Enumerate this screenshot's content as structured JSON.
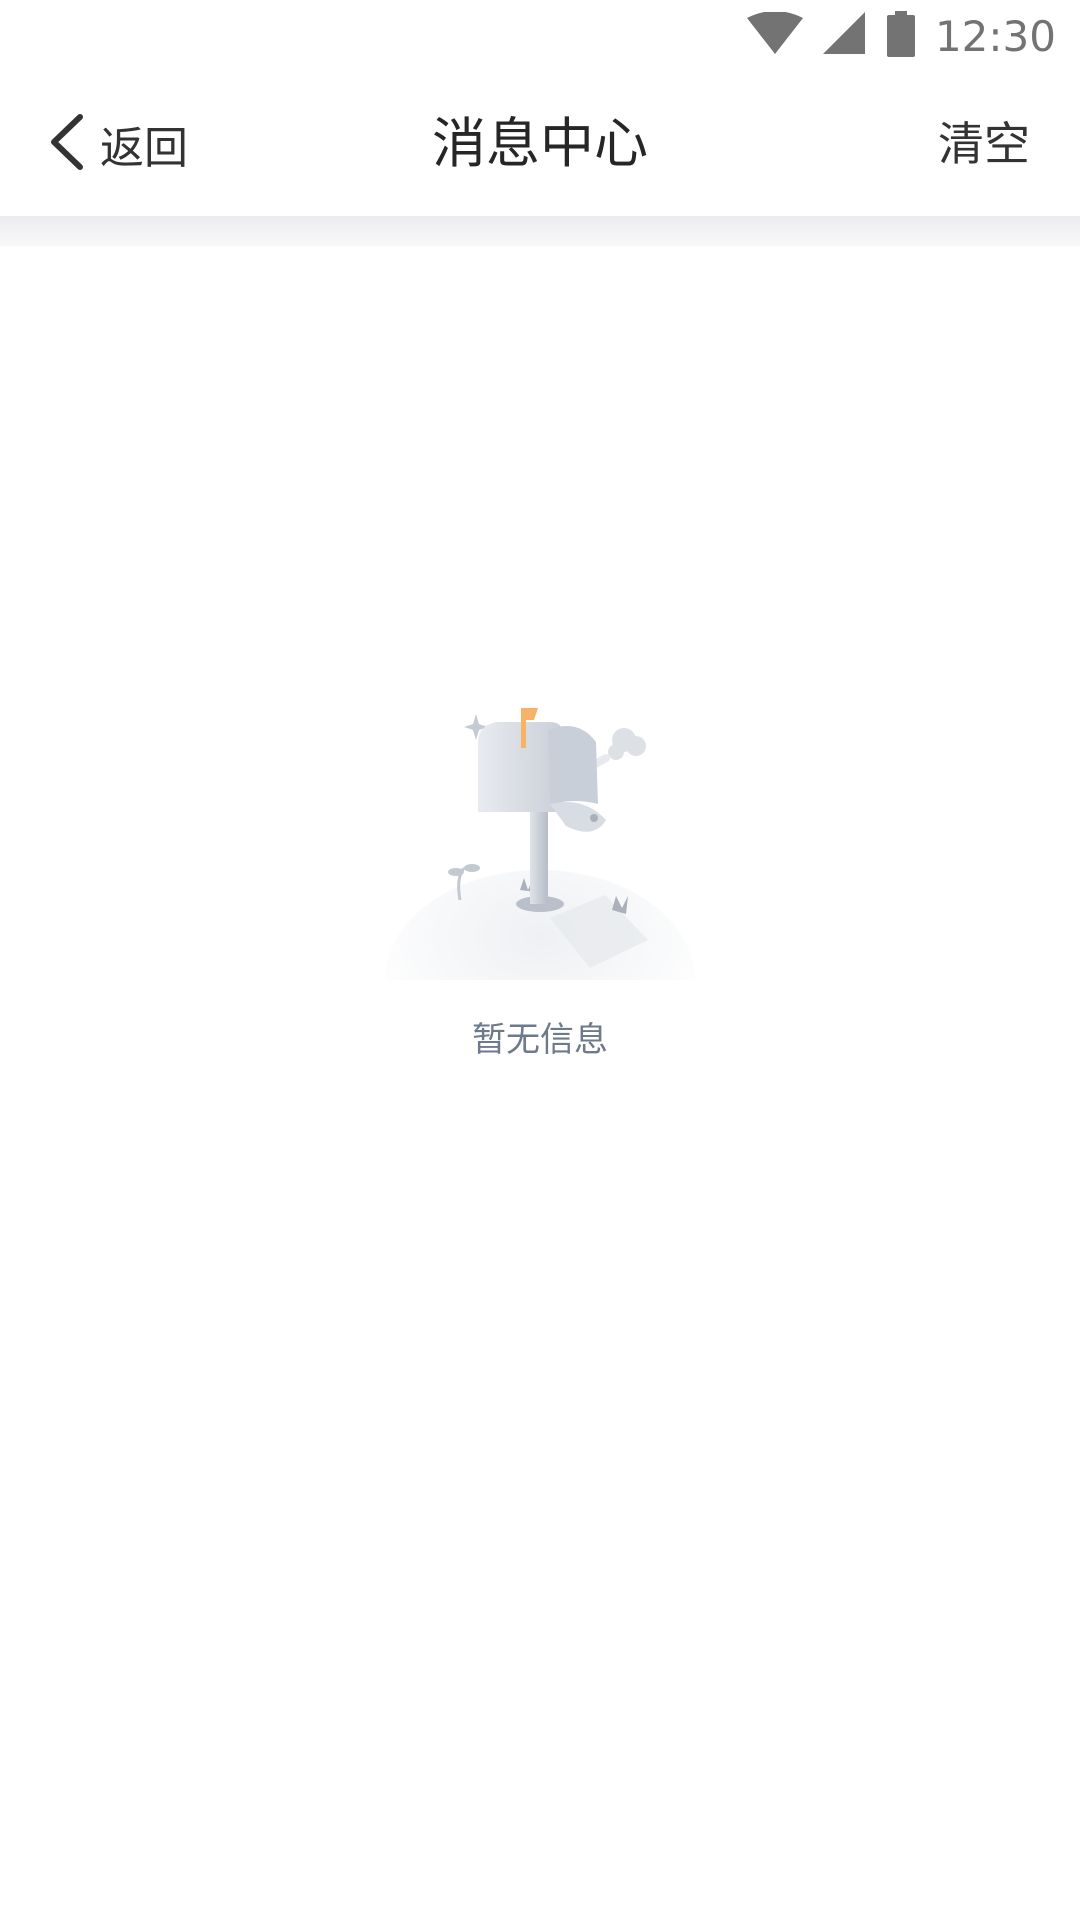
{
  "status_bar": {
    "time": "12:30",
    "icons": [
      "wifi-icon",
      "cell-signal-icon",
      "battery-icon"
    ],
    "icon_color": "#737373"
  },
  "nav": {
    "back_label": "返回",
    "title": "消息中心",
    "clear_label": "清空",
    "back_icon": "chevron-left-icon"
  },
  "empty_state": {
    "message": "暂无信息",
    "illustration": "mailbox-illustration",
    "text_color": "#6e7a8c",
    "flag_color": "#f7b267"
  }
}
